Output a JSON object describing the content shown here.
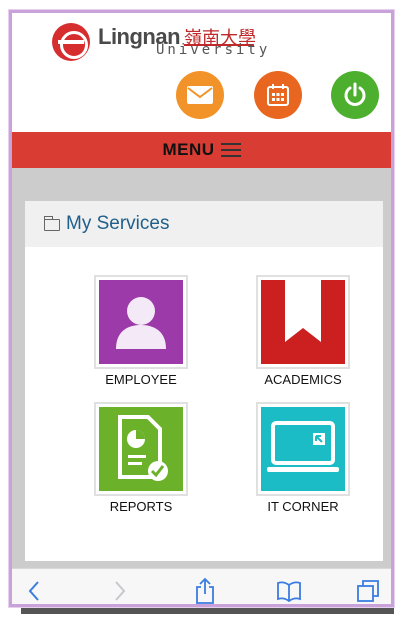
{
  "header": {
    "logo_en": "Lingnan",
    "logo_zh": "嶺南大學",
    "logo_sub": "University"
  },
  "actions": {
    "mail_icon": "mail-icon",
    "calendar_icon": "calendar-icon",
    "power_icon": "power-icon",
    "colors": {
      "mail": "#f29329",
      "calendar": "#e8661f",
      "power": "#4caf2d"
    }
  },
  "menu": {
    "label": "MENU",
    "bar_color": "#d83c33"
  },
  "services": {
    "title": "My Services",
    "tiles": [
      {
        "label": "EMPLOYEE",
        "icon": "person-icon",
        "color": "#9b3aa8"
      },
      {
        "label": "ACADEMICS",
        "icon": "bookmark-icon",
        "color": "#cc1f1f"
      },
      {
        "label": "REPORTS",
        "icon": "report-document-icon",
        "color": "#6bb22a"
      },
      {
        "label": "IT CORNER",
        "icon": "monitor-cursor-icon",
        "color": "#1bbcc6"
      }
    ]
  },
  "toolbar": {
    "items": [
      "back-icon",
      "forward-icon",
      "share-icon",
      "bookmarks-icon",
      "tabs-icon"
    ]
  }
}
